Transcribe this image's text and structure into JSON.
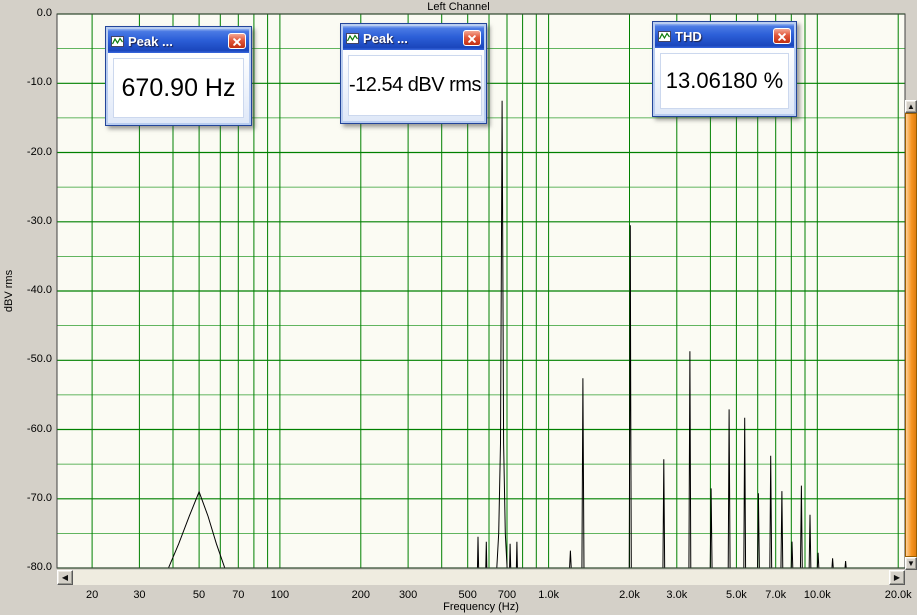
{
  "panels": [
    {
      "title": "Peak ...",
      "value": "670.90 Hz"
    },
    {
      "title": "Peak ...",
      "value": "-12.54 dBV rms"
    },
    {
      "title": "THD",
      "value": "13.06180 %"
    }
  ],
  "icons": {
    "scroll_left": "◀",
    "scroll_right": "▶",
    "scroll_up": "▲",
    "scroll_down": "▼"
  },
  "chart_data": {
    "type": "line",
    "title": "Left Channel",
    "xlabel": "Frequency (Hz)",
    "ylabel": "dBV rms",
    "x_scale": "log",
    "xlim": [
      14.8,
      21200
    ],
    "ylim": [
      -80,
      0
    ],
    "plot_bg": "#fbfbf3",
    "grid_color": "#008000",
    "grid_minor_color": "#2e9e2e",
    "trace_color": "#000000",
    "frame_color": "#404040",
    "y_ticks": [
      0,
      -10,
      -20,
      -30,
      -40,
      -50,
      -60,
      -70,
      -80
    ],
    "y_tick_labels": [
      "0.0",
      "-10.0",
      "-20.0",
      "-30.0",
      "-40.0",
      "-50.0",
      "-60.0",
      "-70.0",
      "-80.0"
    ],
    "y_minor_gridlines": [
      -5,
      -15,
      -25,
      -35,
      -45,
      -55,
      -65,
      -75
    ],
    "x_gridlines": [
      20,
      30,
      40,
      50,
      60,
      70,
      80,
      90,
      100,
      200,
      300,
      400,
      500,
      600,
      700,
      800,
      900,
      1000,
      2000,
      3000,
      4000,
      5000,
      6000,
      7000,
      8000,
      9000,
      10000,
      20000
    ],
    "x_ticks_labeled": [
      [
        20,
        "20"
      ],
      [
        30,
        "30"
      ],
      [
        50,
        "50"
      ],
      [
        70,
        "70"
      ],
      [
        100,
        "100"
      ],
      [
        200,
        "200"
      ],
      [
        300,
        "300"
      ],
      [
        500,
        "500"
      ],
      [
        700,
        "700"
      ],
      [
        1000,
        "1.0k"
      ],
      [
        2000,
        "2.0k"
      ],
      [
        3000,
        "3.0k"
      ],
      [
        5000,
        "5.0k"
      ],
      [
        7000,
        "7.0k"
      ],
      [
        10000,
        "10.0k"
      ],
      [
        20000,
        "20.0k"
      ]
    ],
    "fundamental_hz": 670.9,
    "fundamental_dbv": -12.54,
    "thd_percent": 13.0618,
    "trace": [
      [
        15,
        -80.5
      ],
      [
        38,
        -80.5
      ],
      [
        42,
        -76.5
      ],
      [
        46,
        -72.5
      ],
      [
        50,
        -69
      ],
      [
        54,
        -72.5
      ],
      [
        58,
        -76.5
      ],
      [
        63,
        -80.5
      ],
      [
        520,
        -80.5
      ],
      [
        543,
        -80.5
      ],
      [
        546,
        -75.5
      ],
      [
        549,
        -80.5
      ],
      [
        583,
        -80.5
      ],
      [
        586,
        -76.2
      ],
      [
        589,
        -80.5
      ],
      [
        640,
        -80.5
      ],
      [
        652,
        -75
      ],
      [
        662,
        -62
      ],
      [
        667,
        -35
      ],
      [
        670.9,
        -12.54
      ],
      [
        675,
        -35
      ],
      [
        680,
        -62
      ],
      [
        690,
        -75
      ],
      [
        702,
        -80.5
      ],
      [
        715,
        -80.5
      ],
      [
        719,
        -76.5
      ],
      [
        723,
        -80.5
      ],
      [
        758,
        -80.5
      ],
      [
        762,
        -76.2
      ],
      [
        766,
        -80.5
      ],
      [
        1195,
        -80.5
      ],
      [
        1205,
        -77.5
      ],
      [
        1215,
        -80.5
      ],
      [
        1330,
        -80.5
      ],
      [
        1341.8,
        -52.6
      ],
      [
        1354,
        -80.5
      ],
      [
        1995,
        -80.5
      ],
      [
        2005,
        -55
      ],
      [
        2012.7,
        -30.5
      ],
      [
        2021,
        -55
      ],
      [
        2031,
        -80.5
      ],
      [
        2662,
        -80.5
      ],
      [
        2683.6,
        -64.3
      ],
      [
        2705,
        -80.5
      ],
      [
        3328,
        -80.5
      ],
      [
        3354.5,
        -48.7
      ],
      [
        3381,
        -80.5
      ],
      [
        3993,
        -80.5
      ],
      [
        4025.4,
        -68.5
      ],
      [
        4058,
        -80.5
      ],
      [
        4659,
        -80.5
      ],
      [
        4696.3,
        -57.1
      ],
      [
        4734,
        -80.5
      ],
      [
        5324,
        -80.5
      ],
      [
        5367.2,
        -58.3
      ],
      [
        5410,
        -80.5
      ],
      [
        5990,
        -80.5
      ],
      [
        6038.1,
        -69.2
      ],
      [
        6086,
        -80.5
      ],
      [
        6656,
        -80.5
      ],
      [
        6709,
        -63.8
      ],
      [
        6762,
        -80.5
      ],
      [
        7321,
        -80.5
      ],
      [
        7379.9,
        -68.9
      ],
      [
        7439,
        -80.5
      ],
      [
        7986,
        -80.5
      ],
      [
        8050.8,
        -76.2
      ],
      [
        8115,
        -80.5
      ],
      [
        8652,
        -80.5
      ],
      [
        8721.7,
        -68.1
      ],
      [
        8791,
        -80.5
      ],
      [
        9318,
        -80.5
      ],
      [
        9392.6,
        -72.3
      ],
      [
        9467,
        -80.5
      ],
      [
        9984,
        -80.5
      ],
      [
        10063.5,
        -77.8
      ],
      [
        10144,
        -80.5
      ],
      [
        11310,
        -80.5
      ],
      [
        11400,
        -78.6
      ],
      [
        11490,
        -80.5
      ],
      [
        12650,
        -80.5
      ],
      [
        12745,
        -79
      ],
      [
        12840,
        -80.5
      ],
      [
        21200,
        -80.5
      ]
    ]
  }
}
